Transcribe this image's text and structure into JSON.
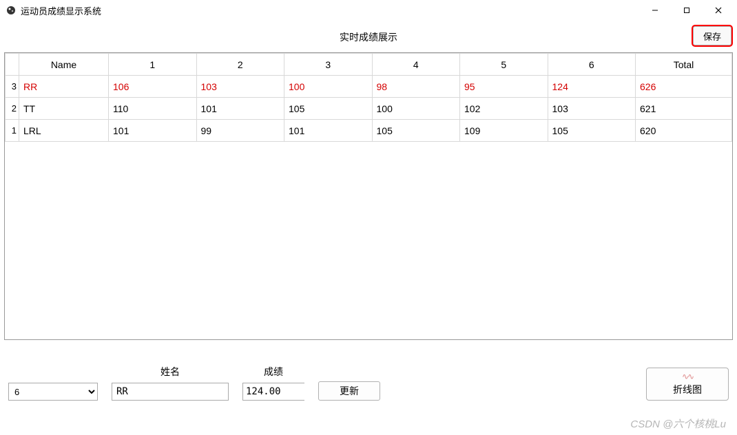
{
  "window": {
    "title": "运动员成绩显示系统"
  },
  "header": {
    "center_label": "实时成绩展示",
    "save_label": "保存"
  },
  "table": {
    "columns": [
      "Name",
      "1",
      "2",
      "3",
      "4",
      "5",
      "6",
      "Total"
    ],
    "rows": [
      {
        "rownum": "3",
        "highlight": true,
        "cells": [
          "RR",
          "106",
          "103",
          "100",
          "98",
          "95",
          "124",
          "626"
        ]
      },
      {
        "rownum": "2",
        "highlight": false,
        "cells": [
          "TT",
          "110",
          "101",
          "105",
          "100",
          "102",
          "103",
          "621"
        ]
      },
      {
        "rownum": "1",
        "highlight": false,
        "cells": [
          "LRL",
          "101",
          "99",
          "101",
          "105",
          "109",
          "105",
          "620"
        ]
      }
    ]
  },
  "controls": {
    "round_select_value": "6",
    "name_label": "姓名",
    "name_value": "RR",
    "score_label": "成绩",
    "score_value": "124.00",
    "update_label": "更新",
    "chart_label": "折线图"
  },
  "watermark": "CSDN @六个核桃Lu"
}
